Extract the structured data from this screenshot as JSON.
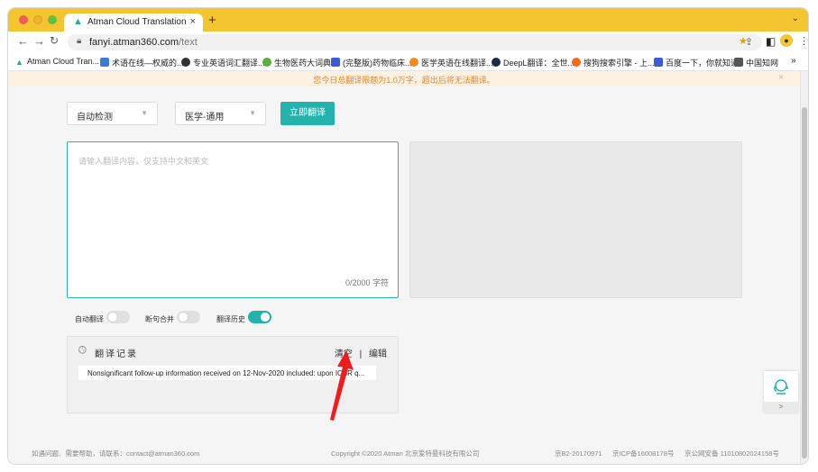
{
  "tab": {
    "title": "Atman Cloud Translation",
    "close": "×"
  },
  "new_tab": "+",
  "address_bar": {
    "domain": "fanyi.atman360.com",
    "path": "/text"
  },
  "bookmarks": [
    {
      "label": "Atman Cloud Tran...",
      "color": "#2aa89a"
    },
    {
      "label": "术语在线—权威的...",
      "color": "#3a7bd5"
    },
    {
      "label": "专业英语词汇翻译...",
      "color": "#333333"
    },
    {
      "label": "生物医药大词典",
      "color": "#5ab03a"
    },
    {
      "label": "(完整版)药物临床...",
      "color": "#3b5bdb"
    },
    {
      "label": "医学英语在线翻译...",
      "color": "#f08c1e"
    },
    {
      "label": "DeepL翻译：全世...",
      "color": "#1c2a44"
    },
    {
      "label": "搜狗搜索引擎 - 上...",
      "color": "#f26b1d"
    },
    {
      "label": "百度一下，你就知道",
      "color": "#3b5bdb"
    },
    {
      "label": "中国知网",
      "color": "#555555"
    }
  ],
  "bookmarks_more": "»",
  "notice": "您今日总翻译限额为1.0万字，超出后将无法翻译。",
  "controls": {
    "source_lang": "自动检测",
    "domain": "医学-通用",
    "translate_button": "立即翻译"
  },
  "input": {
    "placeholder": "请输入翻译内容，仅支持中文和英文",
    "counter": "0/2000 字符"
  },
  "toggles": {
    "auto_translate": {
      "label": "自动翻译",
      "on": false
    },
    "merge_sentences": {
      "label": "断句合并",
      "on": false
    },
    "history": {
      "label": "翻译历史",
      "on": true
    }
  },
  "history": {
    "title": "翻译记录",
    "clear": "清空",
    "separator": "|",
    "edit": "编辑",
    "items": [
      "Nonsignificant follow-up information received on 12-Nov-2020 included: upon ICSR q..."
    ]
  },
  "footer": {
    "contact": "如遇问题、需要帮助，请联系：contact@atman360.com",
    "copyright": "Copyright ©2020 Atman   北京爱特曼科技有限公司",
    "license1": "京B2-20170971",
    "license2": "京ICP备16008178号",
    "license3": "京公网安备 11010802024158号"
  },
  "side_widget": {
    "expand": ">"
  },
  "colors": {
    "accent": "#24b3ac",
    "titlebar": "#f4c531",
    "notice": "#e6862e",
    "arrow": "#ee1c1c"
  }
}
